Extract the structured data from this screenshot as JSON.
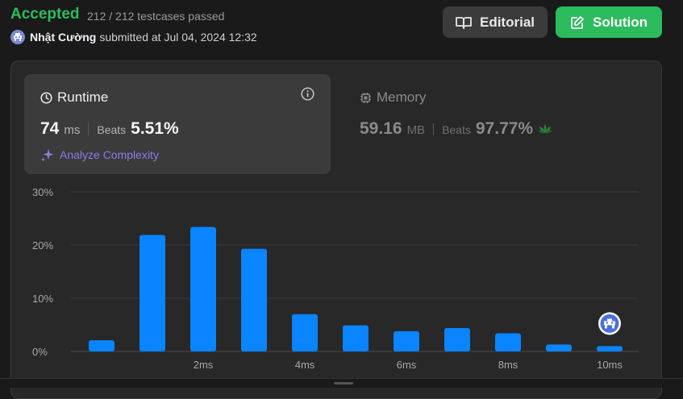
{
  "header": {
    "status": "Accepted",
    "testcases": "212 / 212 testcases passed",
    "user_name": "Nhật Cường",
    "submitted_text": "submitted at Jul 04, 2024 12:32",
    "editorial_label": "Editorial",
    "solution_label": "Solution"
  },
  "runtime": {
    "title": "Runtime",
    "value": "74",
    "unit": "ms",
    "beats_label": "Beats",
    "beats_value": "5.51%",
    "analyze_label": "Analyze Complexity"
  },
  "memory": {
    "title": "Memory",
    "value": "59.16",
    "unit": "MB",
    "beats_label": "Beats",
    "beats_value": "97.77%"
  },
  "colors": {
    "accepted": "#2cbb5d",
    "bar": "#0a84ff",
    "analyze": "#8b7bea"
  },
  "chart_data": {
    "type": "bar",
    "y_ticks": [
      "30%",
      "20%",
      "10%",
      "0%"
    ],
    "x_tick_labels": [
      "2ms",
      "4ms",
      "6ms",
      "8ms",
      "10ms"
    ],
    "ylim": [
      0,
      30
    ],
    "values": [
      2.1,
      21.9,
      23.4,
      19.3,
      7.0,
      4.9,
      3.8,
      4.4,
      3.4,
      1.3,
      1.0
    ],
    "highlighted_index": 10
  }
}
